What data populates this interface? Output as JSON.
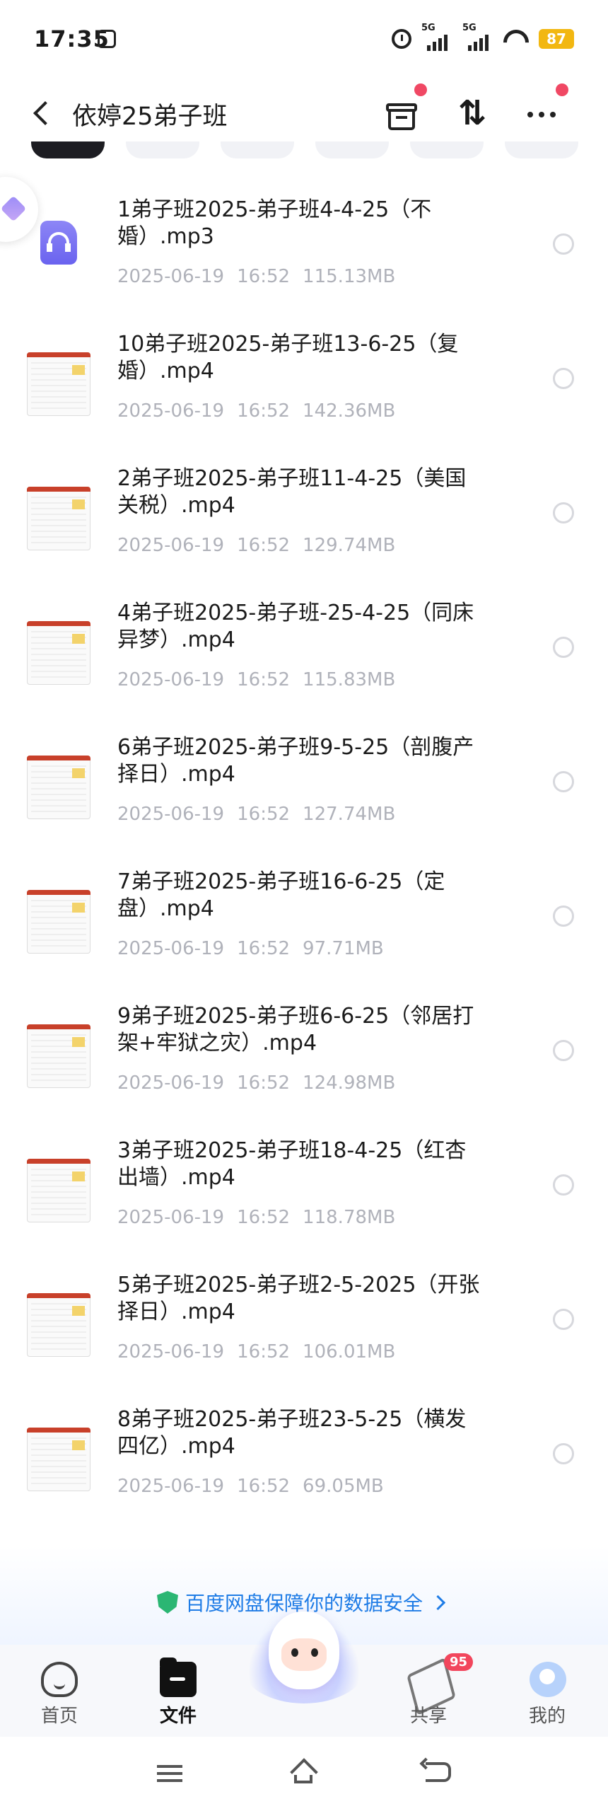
{
  "status_bar": {
    "time": "17:35",
    "net1": "5G",
    "net2": "5G",
    "battery": "87"
  },
  "header": {
    "title": "依婷25弟子班"
  },
  "files": [
    {
      "name": "1弟子班2025-弟子班4-4-25（不\n婚）.mp3",
      "date": "2025-06-19",
      "time": "16:52",
      "size": "115.13MB",
      "type": "audio"
    },
    {
      "name": "10弟子班2025-弟子班13-6-25（复\n婚）.mp4",
      "date": "2025-06-19",
      "time": "16:52",
      "size": "142.36MB",
      "type": "video"
    },
    {
      "name": "2弟子班2025-弟子班11-4-25（美国\n关税）.mp4",
      "date": "2025-06-19",
      "time": "16:52",
      "size": "129.74MB",
      "type": "video"
    },
    {
      "name": "4弟子班2025-弟子班-25-4-25（同床\n异梦）.mp4",
      "date": "2025-06-19",
      "time": "16:52",
      "size": "115.83MB",
      "type": "video"
    },
    {
      "name": "6弟子班2025-弟子班9-5-25（剖腹产\n择日）.mp4",
      "date": "2025-06-19",
      "time": "16:52",
      "size": "127.74MB",
      "type": "video"
    },
    {
      "name": "7弟子班2025-弟子班16-6-25（定\n盘）.mp4",
      "date": "2025-06-19",
      "time": "16:52",
      "size": "97.71MB",
      "type": "video"
    },
    {
      "name": "9弟子班2025-弟子班6-6-25（邻居打\n架+牢狱之灾）.mp4",
      "date": "2025-06-19",
      "time": "16:52",
      "size": "124.98MB",
      "type": "video"
    },
    {
      "name": "3弟子班2025-弟子班18-4-25（红杏\n出墙）.mp4",
      "date": "2025-06-19",
      "time": "16:52",
      "size": "118.78MB",
      "type": "video"
    },
    {
      "name": "5弟子班2025-弟子班2-5-2025（开张\n择日）.mp4",
      "date": "2025-06-19",
      "time": "16:52",
      "size": "106.01MB",
      "type": "video"
    },
    {
      "name": "8弟子班2025-弟子班23-5-25（横发\n四亿）.mp4",
      "date": "2025-06-19",
      "time": "16:52",
      "size": "69.05MB",
      "type": "video"
    }
  ],
  "banner": {
    "text": "百度网盘保障你的数据安全"
  },
  "bottom_nav": {
    "home": "首页",
    "files": "文件",
    "share": "共享",
    "share_badge": "95",
    "me": "我的"
  }
}
